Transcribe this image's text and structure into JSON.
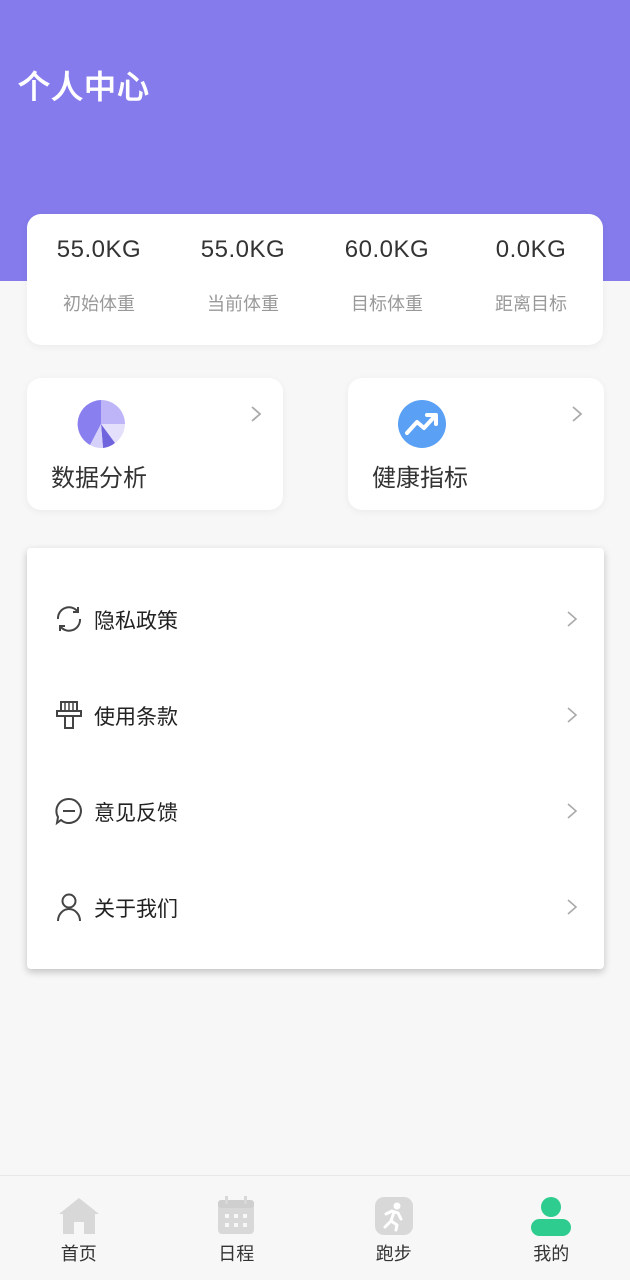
{
  "header": {
    "title": "个人中心"
  },
  "stats": [
    {
      "value": "55.0KG",
      "label": "初始体重"
    },
    {
      "value": "55.0KG",
      "label": "当前体重"
    },
    {
      "value": "60.0KG",
      "label": "目标体重"
    },
    {
      "value": "0.0KG",
      "label": "距离目标"
    }
  ],
  "features": {
    "data_analysis": {
      "label": "数据分析",
      "icon": "pie-chart-icon"
    },
    "health_index": {
      "label": "健康指标",
      "icon": "trend-up-icon"
    }
  },
  "menu": [
    {
      "label": "隐私政策",
      "icon": "refresh-icon"
    },
    {
      "label": "使用条款",
      "icon": "pin-icon"
    },
    {
      "label": "意见反馈",
      "icon": "chat-bubble-icon"
    },
    {
      "label": "关于我们",
      "icon": "user-icon"
    }
  ],
  "tabbar": [
    {
      "label": "首页",
      "icon": "home-icon"
    },
    {
      "label": "日程",
      "icon": "calendar-icon"
    },
    {
      "label": "跑步",
      "icon": "running-icon"
    },
    {
      "label": "我的",
      "icon": "profile-icon",
      "active": true
    }
  ],
  "colors": {
    "header": "#857bec",
    "accent_active": "#2ecc8e",
    "tab_inactive": "#d8d8d8"
  }
}
